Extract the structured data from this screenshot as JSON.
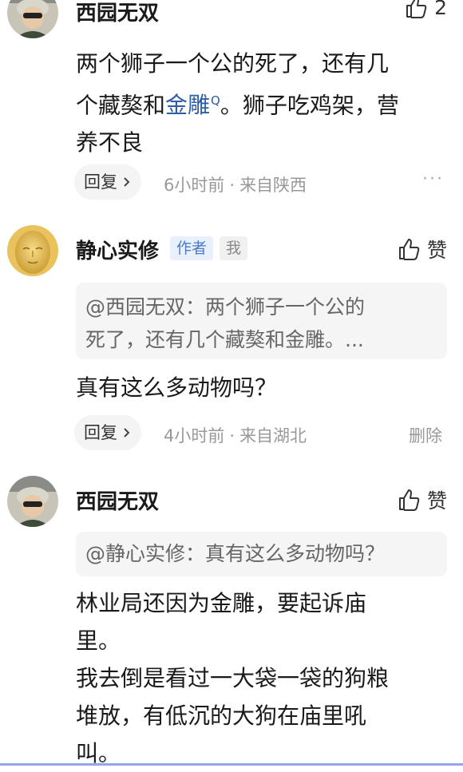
{
  "comments": [
    {
      "username": "西园无双",
      "like_count": "2",
      "text_lines": [
        "两个狮子一个公的死了，还有几",
        "个藏獒和",
        "金雕",
        "。狮子吃鸡架，营",
        "养不良"
      ],
      "reply_label": "回复",
      "time": "6小时前",
      "location": "来自陕西",
      "more_label": "···"
    },
    {
      "username": "静心实修",
      "author_tag": "作者",
      "me_tag": "我",
      "like_label": "赞",
      "quote_lines": [
        "@西园无双：两个狮子一个公的",
        "死了，还有几个藏獒和金雕。..."
      ],
      "text": "真有这么多动物吗？",
      "reply_label": "回复",
      "time": "4小时前",
      "location": "来自湖北",
      "delete_label": "删除"
    },
    {
      "username": "西园无双",
      "like_label": "赞",
      "quote_lines": [
        "@静心实修：真有这么多动物吗？"
      ],
      "text_lines": [
        "林业局还因为金雕，要起诉庙",
        "里。",
        "我去倒是看过一大袋一袋的狗粮",
        "堆放，有低沉的大狗在庙里吼",
        "叫。"
      ]
    }
  ],
  "colors": {
    "link": "#2e5ea7",
    "author_tag_bg": "#e8f0fb",
    "author_tag_text": "#4b7bc8",
    "meta_gray": "#999999"
  }
}
